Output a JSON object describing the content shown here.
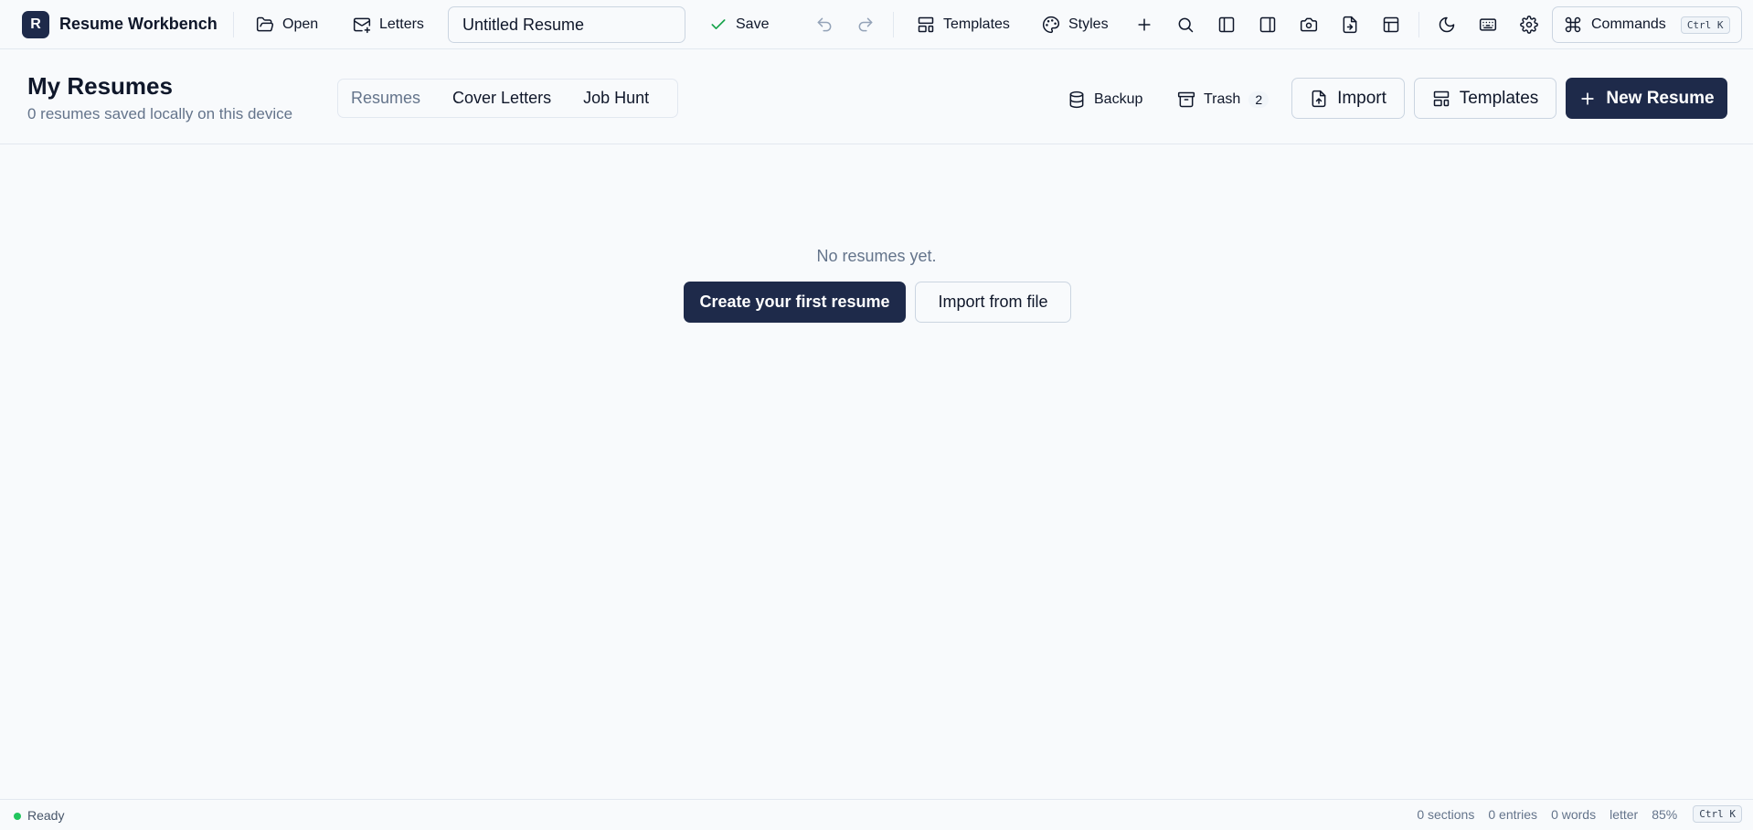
{
  "toolbar": {
    "logo_letter": "R",
    "app_title": "Resume Workbench",
    "open_label": "Open",
    "letters_label": "Letters",
    "document_title": "Untitled Resume",
    "save_label": "Save",
    "templates_label": "Templates",
    "styles_label": "Styles",
    "commands_label": "Commands",
    "commands_shortcut": "Ctrl K",
    "accent_color": "#1e2a4a",
    "save_check_color": "#16a34a",
    "icons": [
      "folder-open-icon",
      "mail-plus-icon",
      "check-icon",
      "undo-icon",
      "redo-icon",
      "layout-template-icon",
      "palette-icon",
      "plus-icon",
      "search-icon",
      "panel-left-icon",
      "panel-right-icon",
      "camera-icon",
      "file-export-icon",
      "layout-icon",
      "moon-icon",
      "keyboard-icon",
      "gear-icon",
      "command-icon"
    ]
  },
  "header": {
    "title": "My Resumes",
    "subtitle": "0 resumes saved locally on this device",
    "tabs": [
      {
        "label": "Resumes",
        "active": true
      },
      {
        "label": "Cover Letters",
        "active": false
      },
      {
        "label": "Job Hunt",
        "active": false
      }
    ],
    "backup_label": "Backup",
    "trash_label": "Trash",
    "trash_count": "2",
    "import_label": "Import",
    "templates_label": "Templates",
    "new_resume_label": "New Resume"
  },
  "main": {
    "empty_message": "No resumes yet.",
    "create_label": "Create your first resume",
    "import_label": "Import from file"
  },
  "status": {
    "ready": "Ready",
    "ready_color": "#22c55e",
    "sections": "0 sections",
    "entries": "0 entries",
    "words": "0 words",
    "page_size": "letter",
    "zoom": "85%",
    "shortcut": "Ctrl K"
  }
}
